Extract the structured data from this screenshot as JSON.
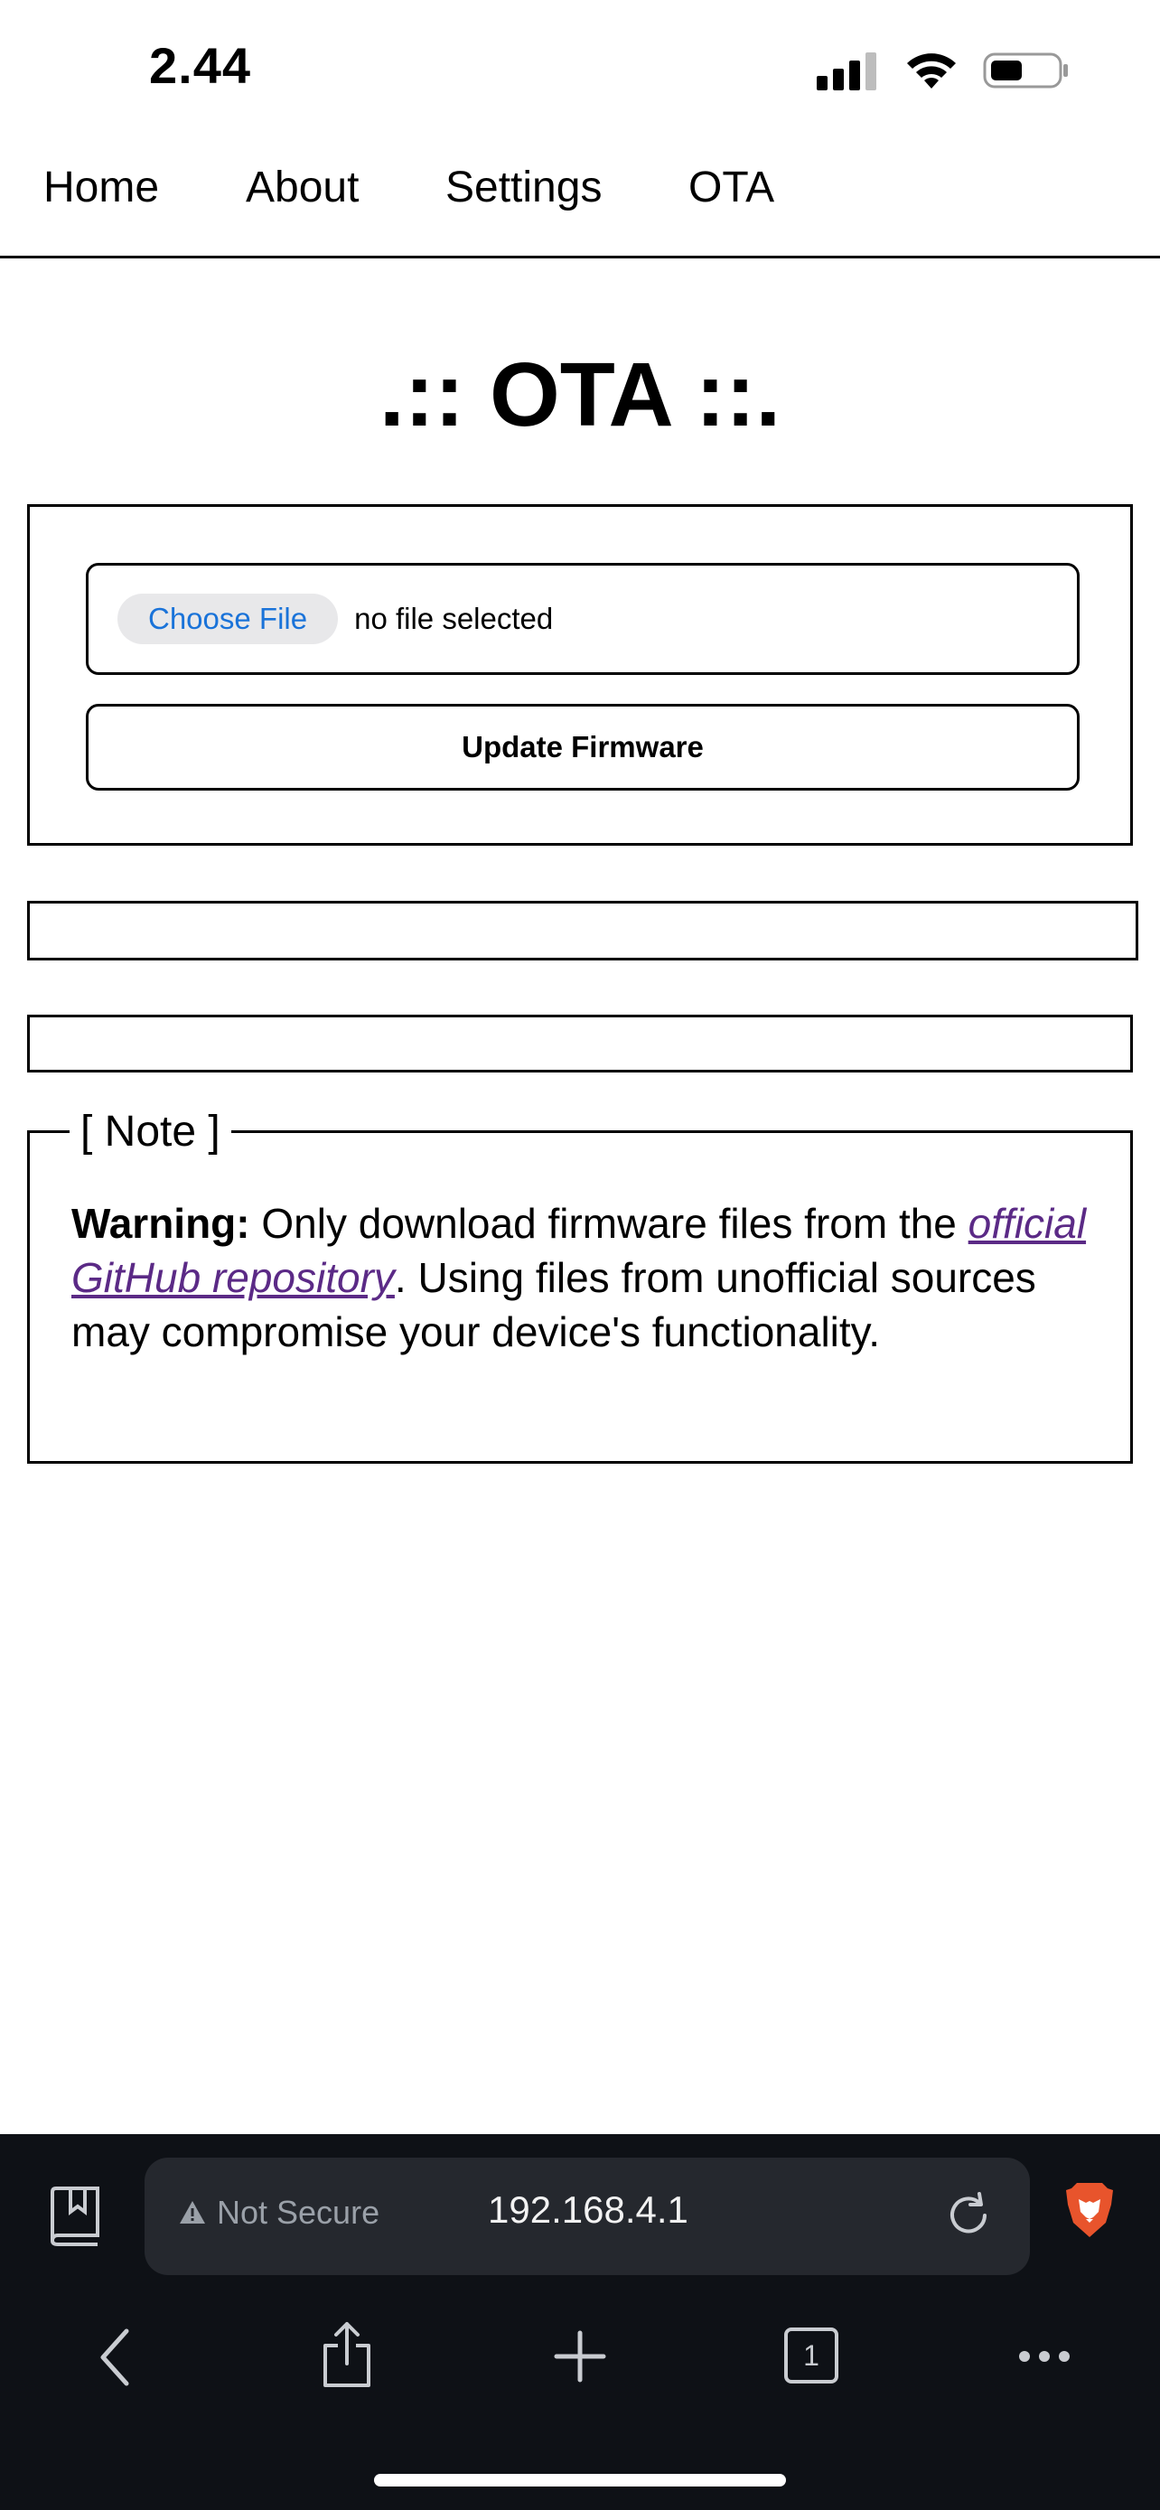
{
  "status_bar": {
    "time": "2.44"
  },
  "nav": {
    "links": [
      "Home",
      "About",
      "Settings",
      "OTA"
    ]
  },
  "page": {
    "title": ".:: OTA ::.",
    "choose_file_label": "Choose File",
    "file_status": "no file selected",
    "update_button": "Update Firmware"
  },
  "note": {
    "legend": "[ Note ]",
    "warning_label": "Warning:",
    "text_before_link": " Only download firmware files from the ",
    "link_text": "official GitHub repository",
    "text_after_link": ". Using files from unofficial sources may compromise your device's functionality."
  },
  "browser": {
    "security_label": "Not Secure",
    "url": "192.168.4.1",
    "tab_count": "1",
    "icons": [
      "bookmarks-icon",
      "warning-icon",
      "reload-icon",
      "brave-lion-icon",
      "back-icon",
      "share-icon",
      "new-tab-icon",
      "tabs-icon",
      "more-icon"
    ]
  },
  "colors": {
    "link_visited": "#5b2a86",
    "choose_file_text": "#1a73d9",
    "browser_bg": "#0e1116",
    "url_field_bg": "#25282e",
    "brave_orange": "#e8542c"
  }
}
